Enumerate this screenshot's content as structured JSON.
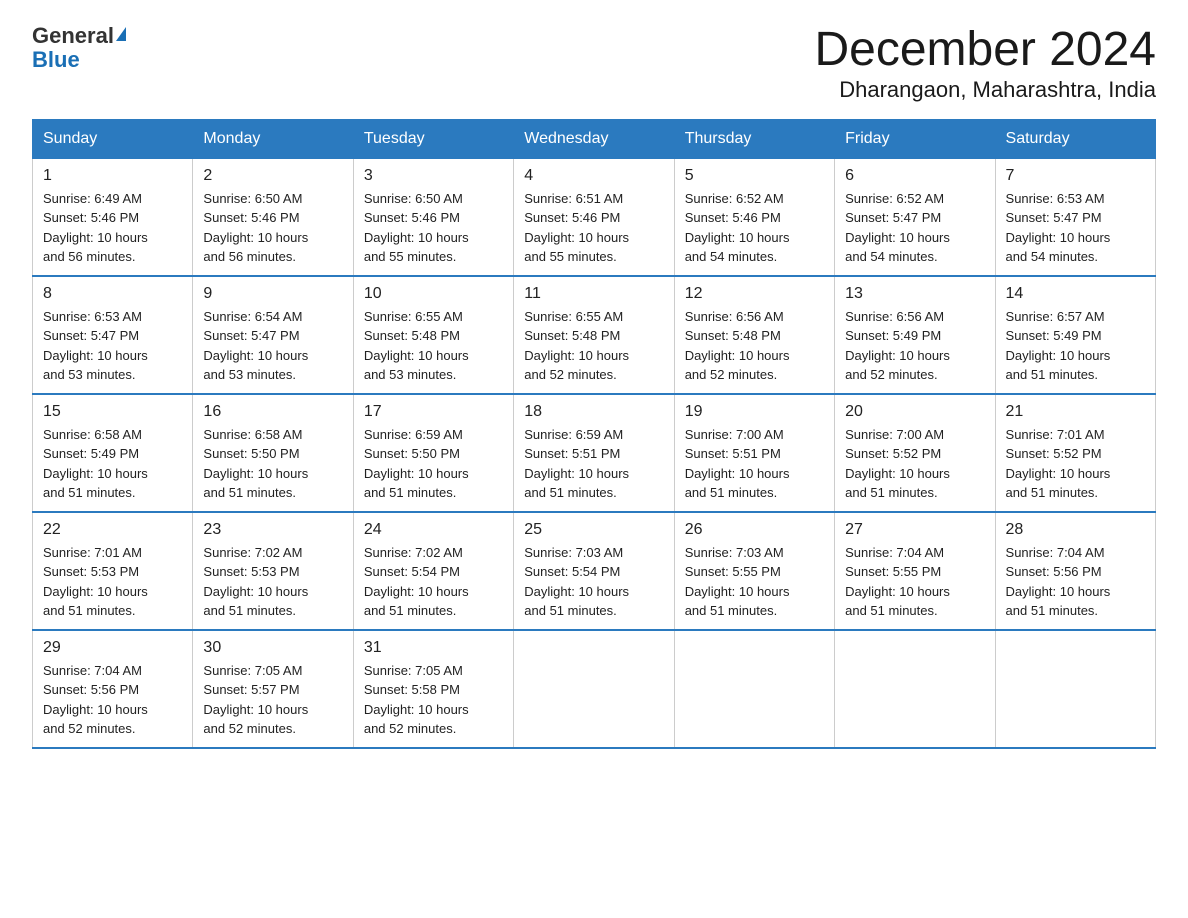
{
  "header": {
    "logo_general": "General",
    "logo_blue": "Blue",
    "title": "December 2024",
    "subtitle": "Dharangaon, Maharashtra, India"
  },
  "days_of_week": [
    "Sunday",
    "Monday",
    "Tuesday",
    "Wednesday",
    "Thursday",
    "Friday",
    "Saturday"
  ],
  "weeks": [
    [
      {
        "day": "1",
        "sunrise": "6:49 AM",
        "sunset": "5:46 PM",
        "daylight": "10 hours and 56 minutes."
      },
      {
        "day": "2",
        "sunrise": "6:50 AM",
        "sunset": "5:46 PM",
        "daylight": "10 hours and 56 minutes."
      },
      {
        "day": "3",
        "sunrise": "6:50 AM",
        "sunset": "5:46 PM",
        "daylight": "10 hours and 55 minutes."
      },
      {
        "day": "4",
        "sunrise": "6:51 AM",
        "sunset": "5:46 PM",
        "daylight": "10 hours and 55 minutes."
      },
      {
        "day": "5",
        "sunrise": "6:52 AM",
        "sunset": "5:46 PM",
        "daylight": "10 hours and 54 minutes."
      },
      {
        "day": "6",
        "sunrise": "6:52 AM",
        "sunset": "5:47 PM",
        "daylight": "10 hours and 54 minutes."
      },
      {
        "day": "7",
        "sunrise": "6:53 AM",
        "sunset": "5:47 PM",
        "daylight": "10 hours and 54 minutes."
      }
    ],
    [
      {
        "day": "8",
        "sunrise": "6:53 AM",
        "sunset": "5:47 PM",
        "daylight": "10 hours and 53 minutes."
      },
      {
        "day": "9",
        "sunrise": "6:54 AM",
        "sunset": "5:47 PM",
        "daylight": "10 hours and 53 minutes."
      },
      {
        "day": "10",
        "sunrise": "6:55 AM",
        "sunset": "5:48 PM",
        "daylight": "10 hours and 53 minutes."
      },
      {
        "day": "11",
        "sunrise": "6:55 AM",
        "sunset": "5:48 PM",
        "daylight": "10 hours and 52 minutes."
      },
      {
        "day": "12",
        "sunrise": "6:56 AM",
        "sunset": "5:48 PM",
        "daylight": "10 hours and 52 minutes."
      },
      {
        "day": "13",
        "sunrise": "6:56 AM",
        "sunset": "5:49 PM",
        "daylight": "10 hours and 52 minutes."
      },
      {
        "day": "14",
        "sunrise": "6:57 AM",
        "sunset": "5:49 PM",
        "daylight": "10 hours and 51 minutes."
      }
    ],
    [
      {
        "day": "15",
        "sunrise": "6:58 AM",
        "sunset": "5:49 PM",
        "daylight": "10 hours and 51 minutes."
      },
      {
        "day": "16",
        "sunrise": "6:58 AM",
        "sunset": "5:50 PM",
        "daylight": "10 hours and 51 minutes."
      },
      {
        "day": "17",
        "sunrise": "6:59 AM",
        "sunset": "5:50 PM",
        "daylight": "10 hours and 51 minutes."
      },
      {
        "day": "18",
        "sunrise": "6:59 AM",
        "sunset": "5:51 PM",
        "daylight": "10 hours and 51 minutes."
      },
      {
        "day": "19",
        "sunrise": "7:00 AM",
        "sunset": "5:51 PM",
        "daylight": "10 hours and 51 minutes."
      },
      {
        "day": "20",
        "sunrise": "7:00 AM",
        "sunset": "5:52 PM",
        "daylight": "10 hours and 51 minutes."
      },
      {
        "day": "21",
        "sunrise": "7:01 AM",
        "sunset": "5:52 PM",
        "daylight": "10 hours and 51 minutes."
      }
    ],
    [
      {
        "day": "22",
        "sunrise": "7:01 AM",
        "sunset": "5:53 PM",
        "daylight": "10 hours and 51 minutes."
      },
      {
        "day": "23",
        "sunrise": "7:02 AM",
        "sunset": "5:53 PM",
        "daylight": "10 hours and 51 minutes."
      },
      {
        "day": "24",
        "sunrise": "7:02 AM",
        "sunset": "5:54 PM",
        "daylight": "10 hours and 51 minutes."
      },
      {
        "day": "25",
        "sunrise": "7:03 AM",
        "sunset": "5:54 PM",
        "daylight": "10 hours and 51 minutes."
      },
      {
        "day": "26",
        "sunrise": "7:03 AM",
        "sunset": "5:55 PM",
        "daylight": "10 hours and 51 minutes."
      },
      {
        "day": "27",
        "sunrise": "7:04 AM",
        "sunset": "5:55 PM",
        "daylight": "10 hours and 51 minutes."
      },
      {
        "day": "28",
        "sunrise": "7:04 AM",
        "sunset": "5:56 PM",
        "daylight": "10 hours and 51 minutes."
      }
    ],
    [
      {
        "day": "29",
        "sunrise": "7:04 AM",
        "sunset": "5:56 PM",
        "daylight": "10 hours and 52 minutes."
      },
      {
        "day": "30",
        "sunrise": "7:05 AM",
        "sunset": "5:57 PM",
        "daylight": "10 hours and 52 minutes."
      },
      {
        "day": "31",
        "sunrise": "7:05 AM",
        "sunset": "5:58 PM",
        "daylight": "10 hours and 52 minutes."
      },
      null,
      null,
      null,
      null
    ]
  ],
  "labels": {
    "sunrise": "Sunrise:",
    "sunset": "Sunset:",
    "daylight": "Daylight:"
  }
}
